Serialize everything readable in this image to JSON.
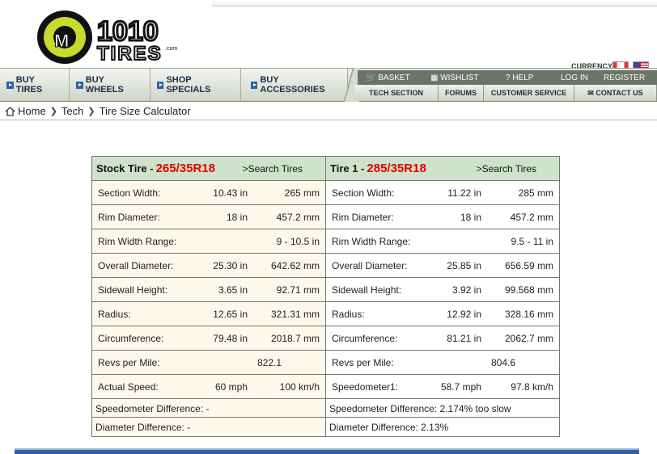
{
  "logo": {
    "icon": "mx-tire-logo",
    "text": "1010",
    "subtext": "TIRES",
    "domain": ".com"
  },
  "currency": {
    "label": "CURRENCY",
    "flags": [
      "canada-flag-icon",
      "usa-flag-icon"
    ]
  },
  "nav": {
    "main": [
      {
        "label": "BUY TIRES"
      },
      {
        "label": "BUY WHEELS"
      },
      {
        "label": "SHOP SPECIALS"
      },
      {
        "label": "BUY ACCESSORIES"
      }
    ],
    "top": {
      "basket": "BASKET",
      "wishlist": "WISHLIST",
      "help": "? HELP",
      "login": "LOG IN",
      "register": "REGISTER"
    },
    "bottom": [
      {
        "label": "TECH SECTION"
      },
      {
        "label": "FORUMS"
      },
      {
        "label": "CUSTOMER SERVICE"
      },
      {
        "label": "CONTACT US"
      }
    ]
  },
  "breadcrumb": {
    "home": "Home",
    "tech": "Tech",
    "current": "Tire Size Calculator"
  },
  "stock": {
    "title": "Stock Tire -",
    "size": "265/35R18",
    "search": ">Search Tires",
    "rows": [
      {
        "label": "Section Width:",
        "v1": "10.43 in",
        "v2": "265 mm"
      },
      {
        "label": "Rim Diameter:",
        "v1": "18 in",
        "v2": "457.2 mm"
      },
      {
        "label": "Rim Width Range:",
        "v1": "",
        "v2": "9 - 10.5 in"
      },
      {
        "label": "Overall Diameter:",
        "v1": "25.30 in",
        "v2": "642.62 mm"
      },
      {
        "label": "Sidewall Height:",
        "v1": "3.65 in",
        "v2": "92.71 mm"
      },
      {
        "label": "Radius:",
        "v1": "12.65 in",
        "v2": "321.31 mm"
      },
      {
        "label": "Circumference:",
        "v1": "79.48 in",
        "v2": "2018.7 mm"
      },
      {
        "label": "Revs per Mile:",
        "center": "822.1"
      },
      {
        "label": "Actual Speed:",
        "v1": "60 mph",
        "v2": "100 km/h"
      }
    ],
    "speedo_diff": "Speedometer Difference: -",
    "diam_diff": "Diameter Difference: -"
  },
  "tire1": {
    "title": "Tire 1 -",
    "size": "285/35R18",
    "search": ">Search Tires",
    "rows": [
      {
        "label": "Section Width:",
        "v1": "11.22 in",
        "v2": "285 mm"
      },
      {
        "label": "Rim Diameter:",
        "v1": "18 in",
        "v2": "457.2 mm"
      },
      {
        "label": "Rim Width Range:",
        "v1": "",
        "v2": "9.5 - 11 in"
      },
      {
        "label": "Overall Diameter:",
        "v1": "25.85 in",
        "v2": "656.59 mm"
      },
      {
        "label": "Sidewall Height:",
        "v1": "3.92 in",
        "v2": "99.568 mm"
      },
      {
        "label": "Radius:",
        "v1": "12.92 in",
        "v2": "328.16 mm"
      },
      {
        "label": "Circumference:",
        "v1": "81.21 in",
        "v2": "2062.7 mm"
      },
      {
        "label": "Revs per Mile:",
        "center": "804.6"
      },
      {
        "label": "Speedometer1:",
        "v1": "58.7 mph",
        "v2": "97.8 km/h"
      }
    ],
    "speedo_diff": "Speedometer Difference: 2.174% too slow",
    "diam_diff": "Diameter Difference: 2.13%"
  }
}
